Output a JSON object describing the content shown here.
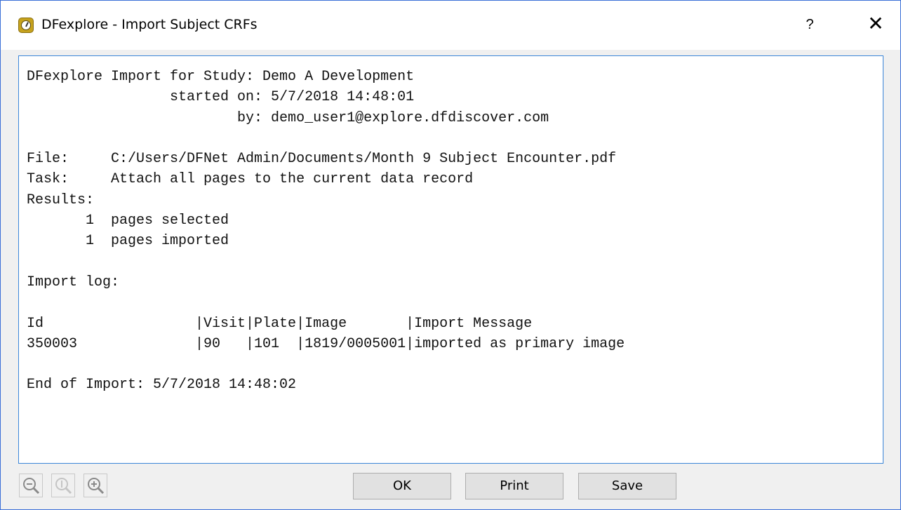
{
  "window": {
    "title": "DFexplore - Import Subject CRFs",
    "app_icon": "dfexplore-clock-icon",
    "help_label": "?",
    "close_label": "✕"
  },
  "log": {
    "lines": [
      "DFexplore Import for Study: Demo A Development",
      "                 started on: 5/7/2018 14:48:01",
      "                         by: demo_user1@explore.dfdiscover.com",
      "",
      "File:     C:/Users/DFNet Admin/Documents/Month 9 Subject Encounter.pdf",
      "Task:     Attach all pages to the current data record",
      "Results:",
      "       1  pages selected",
      "       1  pages imported",
      "",
      "Import log:",
      "",
      "Id                  |Visit|Plate|Image       |Import Message",
      "350003              |90   |101  |1819/0005001|imported as primary image",
      "",
      "End of Import: 5/7/2018 14:48:02"
    ]
  },
  "zoom": {
    "out_icon": "zoom-out-icon",
    "reset_icon": "zoom-reset-icon",
    "in_icon": "zoom-in-icon"
  },
  "buttons": {
    "ok": "OK",
    "print": "Print",
    "save": "Save"
  }
}
